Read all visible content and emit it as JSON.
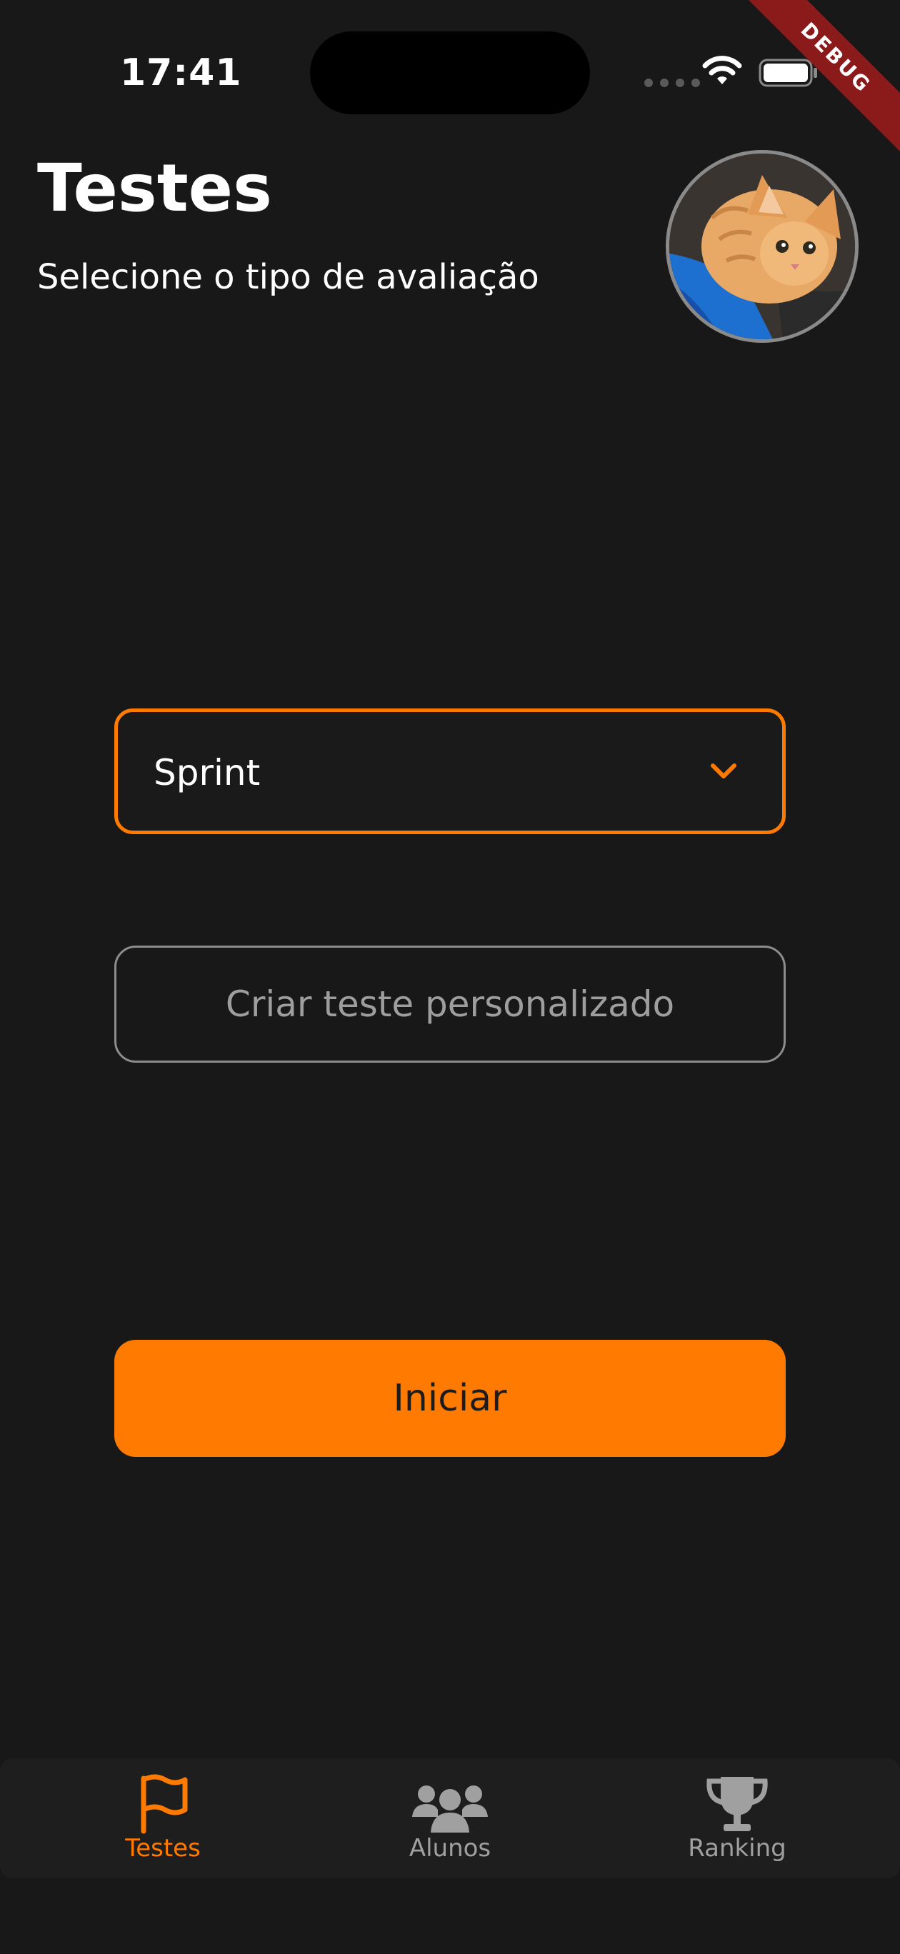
{
  "status_bar": {
    "time": "17:41"
  },
  "debug_banner": "DEBUG",
  "header": {
    "title": "Testes",
    "subtitle": "Selecione o tipo de avaliação"
  },
  "test_type_select": {
    "selected": "Sprint"
  },
  "custom_test_button": "Criar teste personalizado",
  "start_button": "Iniciar",
  "bottom_nav": {
    "items": [
      {
        "label": "Testes",
        "icon": "flag-icon",
        "active": true
      },
      {
        "label": "Alunos",
        "icon": "users-icon",
        "active": false
      },
      {
        "label": "Ranking",
        "icon": "trophy-icon",
        "active": false
      }
    ]
  },
  "colors": {
    "background": "#181818",
    "accent": "#ff7a00",
    "inactive": "#a0a0a0",
    "debug": "#8b1a1a"
  }
}
